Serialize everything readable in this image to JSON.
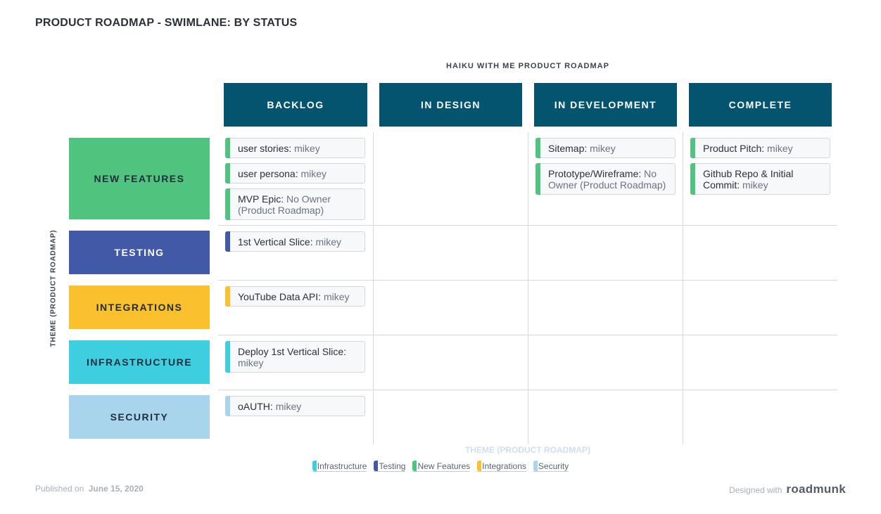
{
  "page_title": "PRODUCT ROADMAP - SWIMLANE: BY STATUS",
  "roadmap_title": "HAIKU WITH ME PRODUCT ROADMAP",
  "columns": [
    "BACKLOG",
    "IN DESIGN",
    "IN DEVELOPMENT",
    "COMPLETE"
  ],
  "y_axis_title": "THEME (PRODUCT ROADMAP)",
  "rows": [
    {
      "label": "NEW FEATURES",
      "color": "#50c47e"
    },
    {
      "label": "TESTING",
      "color": "#4259a8"
    },
    {
      "label": "INTEGRATIONS",
      "color": "#fbc02d"
    },
    {
      "label": "INFRASTRUCTURE",
      "color": "#3dcfe0"
    },
    {
      "label": "SECURITY",
      "color": "#a8d4ec"
    }
  ],
  "cards": {
    "backlog_1": {
      "title": "user stories:",
      "owner": "mikey"
    },
    "backlog_2": {
      "title": "user persona:",
      "owner": "mikey"
    },
    "backlog_3": {
      "title": "MVP Epic:",
      "owner": "No Owner (Product Roadmap)"
    },
    "backlog_4": {
      "title": "1st Vertical Slice:",
      "owner": "mikey"
    },
    "backlog_5": {
      "title": "YouTube Data API:",
      "owner": "mikey"
    },
    "backlog_6": {
      "title": "Deploy 1st Vertical Slice:",
      "owner": "mikey"
    },
    "backlog_7": {
      "title": "oAUTH:",
      "owner": "mikey"
    },
    "dev_1": {
      "title": "Sitemap:",
      "owner": "mikey"
    },
    "dev_2": {
      "title": "Prototype/Wireframe:",
      "owner": "No Owner (Product Roadmap)"
    },
    "complete_1": {
      "title": "Product Pitch:",
      "owner": "mikey"
    },
    "complete_2": {
      "title": "Github Repo & Initial Commit:",
      "owner": "mikey"
    }
  },
  "legend": {
    "title": "THEME (PRODUCT ROADMAP)",
    "items": [
      {
        "label": "Infrastructure",
        "color": "#3dcfe0"
      },
      {
        "label": "Testing",
        "color": "#4259a8"
      },
      {
        "label": "New Features",
        "color": "#50c47e"
      },
      {
        "label": "Integrations",
        "color": "#fbc02d"
      },
      {
        "label": "Security",
        "color": "#a8d4ec"
      }
    ]
  },
  "footer": {
    "published_label": "Published on",
    "published_date": "June 15, 2020",
    "designed_with": "Designed with",
    "brand": "roadmunk"
  }
}
